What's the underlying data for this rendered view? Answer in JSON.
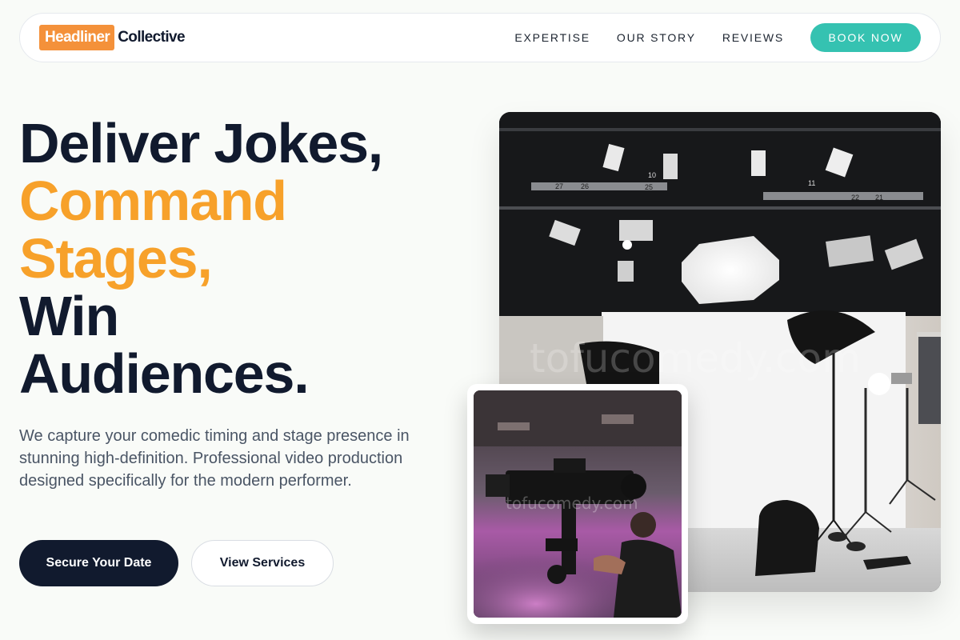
{
  "nav": {
    "logo_highlight": "Headliner",
    "logo_text": "Collective",
    "links": [
      "EXPERTISE",
      "OUR STORY",
      "REVIEWS"
    ],
    "cta_label": "BOOK NOW"
  },
  "hero": {
    "headline_lines": [
      {
        "text": "Deliver Jokes,",
        "tone": "dark"
      },
      {
        "text": "Command",
        "tone": "orange"
      },
      {
        "text": "Stages,",
        "tone": "orange"
      },
      {
        "text": "Win",
        "tone": "dark"
      },
      {
        "text": "Audiences.",
        "tone": "dark"
      }
    ],
    "subtext": "We capture your comedic timing and stage presence in stunning high-definition. Professional video production designed specifically for the modern performer.",
    "primary_button": "Secure Your Date",
    "secondary_button": "View Services"
  },
  "images": {
    "studio_watermark": "tofucomedy.com",
    "camera_watermark": "tofucomedy.com",
    "studio_numbers": [
      "27",
      "26",
      "25",
      "10",
      "11",
      "22",
      "21"
    ]
  },
  "colors": {
    "accent_orange": "#f7a12a",
    "logo_orange": "#f4913a",
    "teal": "#35c2b1",
    "navy": "#111a2e"
  }
}
